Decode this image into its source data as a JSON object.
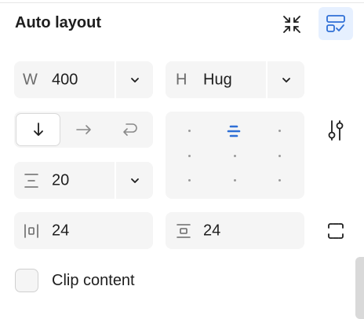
{
  "panel": {
    "title": "Auto layout"
  },
  "icons": {
    "collapse": "collapse-arrows-icon",
    "layout_suggest": "layout-check-icon",
    "settings": "sliders-icon",
    "clip": "clip-frame-icon"
  },
  "width": {
    "prefix": "W",
    "value": "400"
  },
  "height": {
    "prefix": "H",
    "value": "Hug"
  },
  "direction": {
    "options": [
      "vertical",
      "horizontal",
      "wrap"
    ],
    "selected": "vertical"
  },
  "gap": {
    "value": "20"
  },
  "padding": {
    "horizontal": "24",
    "vertical": "24"
  },
  "alignment": {
    "selected": "top-center"
  },
  "clip_content": {
    "label": "Clip content",
    "checked": false
  },
  "colors": {
    "accent": "#2f6fd6",
    "field_bg": "#f5f5f5",
    "active_btn_bg": "#e6f0ff"
  }
}
